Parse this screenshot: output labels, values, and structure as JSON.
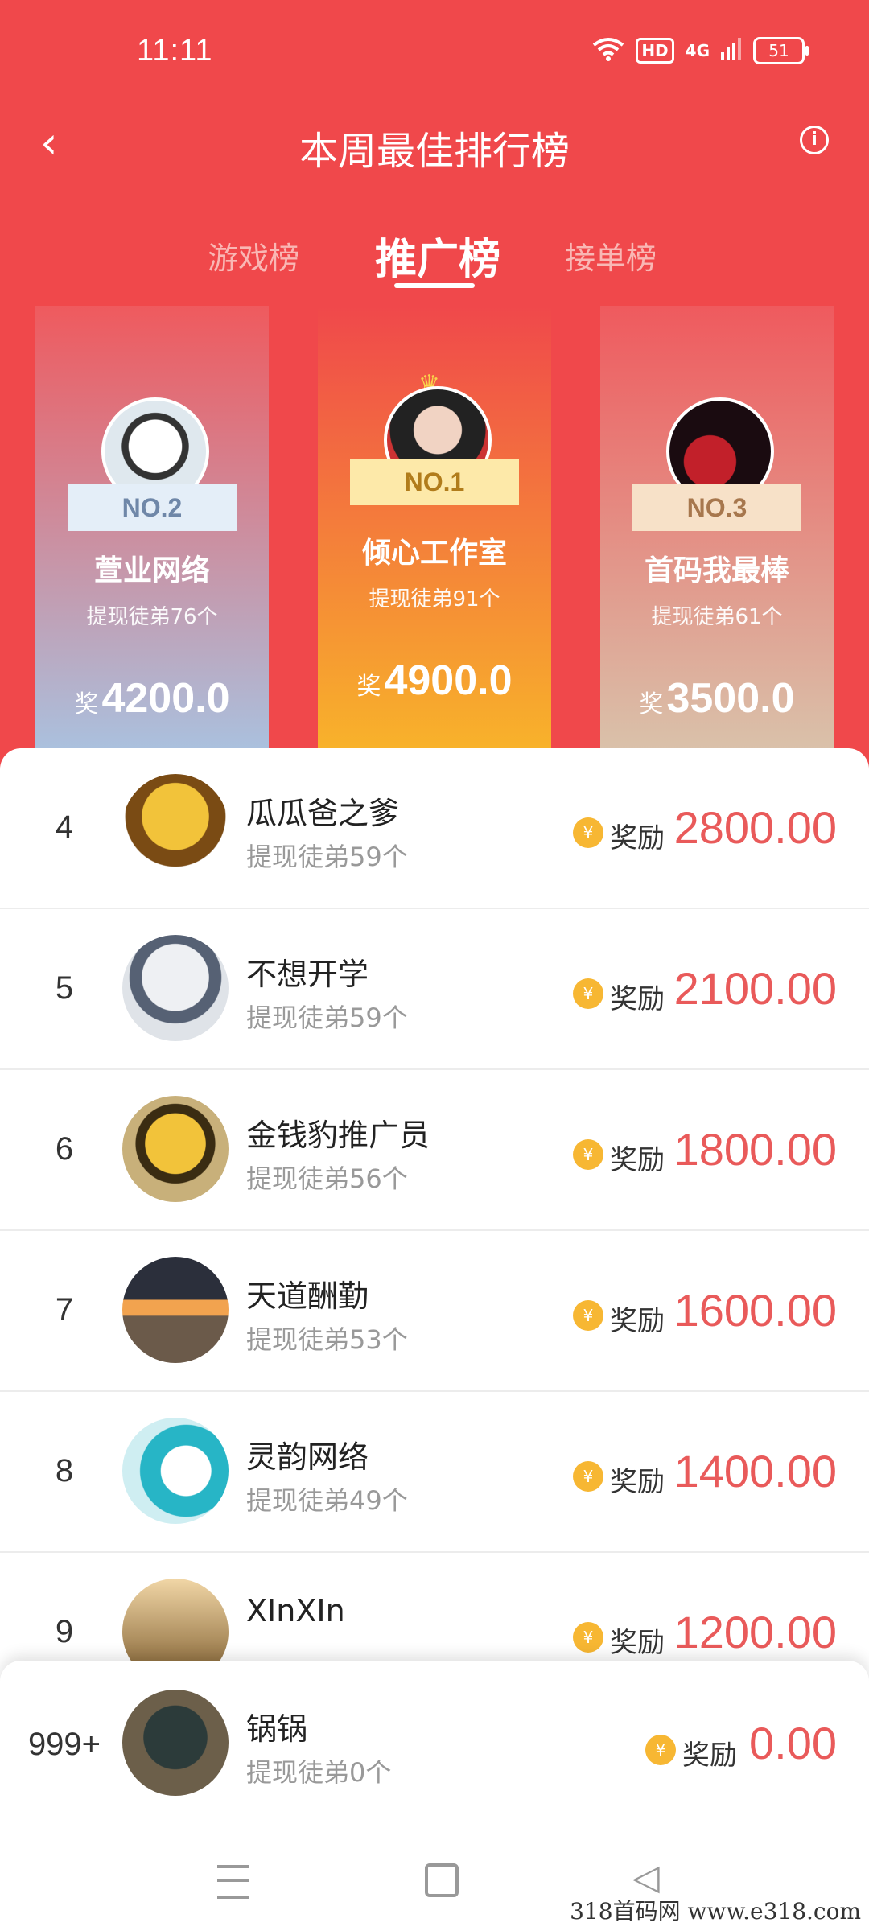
{
  "status_bar": {
    "time": "11:11",
    "hd": "HD",
    "network": "4G",
    "battery": "51"
  },
  "header": {
    "back": "‹",
    "title": "本周最佳排行榜",
    "info": "i"
  },
  "tabs": [
    {
      "label": "游戏榜",
      "active": false
    },
    {
      "label": "推广榜",
      "active": true
    },
    {
      "label": "接单榜",
      "active": false
    }
  ],
  "podium": {
    "first": {
      "badge": "NO.1",
      "name": "倾心工作室",
      "sub": "提现徒弟91个",
      "prize_prefix": "奖",
      "prize": "4900.0"
    },
    "second": {
      "badge": "NO.2",
      "name": "萱业网络",
      "sub": "提现徒弟76个",
      "prize_prefix": "奖",
      "prize": "4200.0"
    },
    "third": {
      "badge": "NO.3",
      "name": "首码我最棒",
      "sub": "提现徒弟61个",
      "prize_prefix": "奖",
      "prize": "3500.0"
    }
  },
  "reward_label": "奖励",
  "coin_symbol": "¥",
  "list": [
    {
      "rank": "4",
      "name": "瓜瓜爸之爹",
      "sub": "提现徒弟59个",
      "amount": "2800.00"
    },
    {
      "rank": "5",
      "name": "不想开学",
      "sub": "提现徒弟59个",
      "amount": "2100.00"
    },
    {
      "rank": "6",
      "name": "金钱豹推广员",
      "sub": "提现徒弟56个",
      "amount": "1800.00"
    },
    {
      "rank": "7",
      "name": "天道酬勤",
      "sub": "提现徒弟53个",
      "amount": "1600.00"
    },
    {
      "rank": "8",
      "name": "灵韵网络",
      "sub": "提现徒弟49个",
      "amount": "1400.00"
    },
    {
      "rank": "9",
      "name": "XInXIn",
      "sub": "",
      "amount": "1200.00"
    }
  ],
  "me": {
    "rank": "999+",
    "name": "锅锅",
    "sub": "提现徒弟0个",
    "amount": "0.00"
  },
  "watermark": "318首码网  www.e318.com",
  "colors": {
    "primary_red": "#f0484b",
    "amount_red": "#e95a5a",
    "coin": "#f7b733"
  }
}
